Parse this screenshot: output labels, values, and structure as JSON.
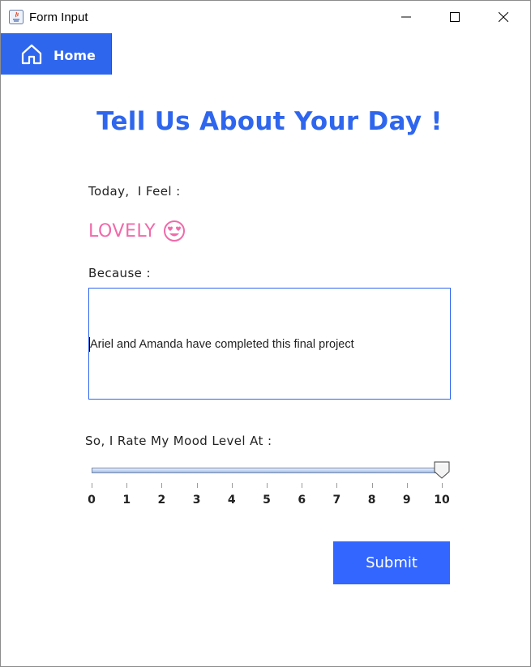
{
  "window": {
    "title": "Form Input"
  },
  "nav": {
    "home_label": "Home"
  },
  "page": {
    "title": "Tell Us About Your Day !"
  },
  "form": {
    "feel_label": "Today,  I Feel :",
    "feeling_value": "LOVELY",
    "feeling_emoji": "heart-eyes-emoji",
    "because_label": "Because :",
    "reason_text": "Ariel and Amanda have completed this final project",
    "rate_label": "So, I Rate My Mood Level At :",
    "slider": {
      "min": 0,
      "max": 10,
      "value": 10,
      "ticks": [
        "0",
        "1",
        "2",
        "3",
        "4",
        "5",
        "6",
        "7",
        "8",
        "9",
        "10"
      ]
    },
    "submit_label": "Submit"
  },
  "colors": {
    "accent": "#2f66ee",
    "feeling": "#f06aaa",
    "submit": "#3366ff"
  }
}
